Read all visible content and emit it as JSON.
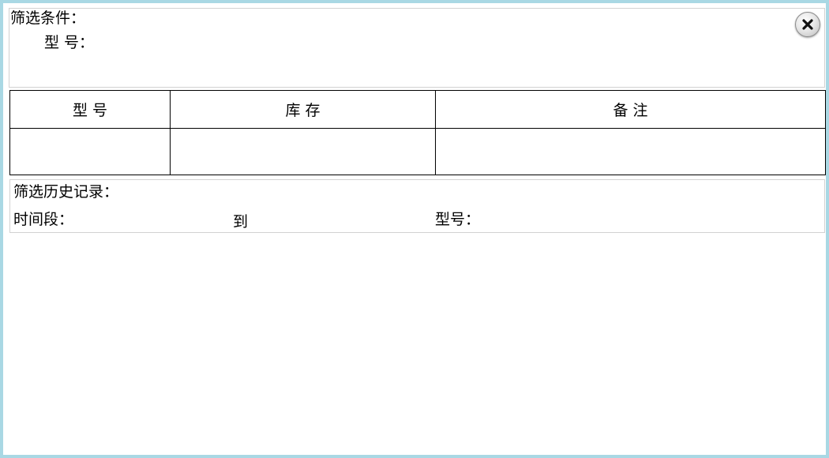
{
  "filter": {
    "title": "筛选条件：",
    "model_label": "型  号："
  },
  "close_button": {
    "icon": "close-icon",
    "glyph": "✕"
  },
  "table": {
    "columns": [
      "型  号",
      "库  存",
      "备  注"
    ],
    "rows": [
      [
        "",
        "",
        ""
      ]
    ]
  },
  "history": {
    "title": "筛选历史记录：",
    "time_label": "时间段：",
    "to_label": "到",
    "model_label": "型号："
  },
  "colors": {
    "frame_border": "#a9d8e4",
    "panel_border": "#d2d2d2",
    "table_border": "#000000"
  }
}
